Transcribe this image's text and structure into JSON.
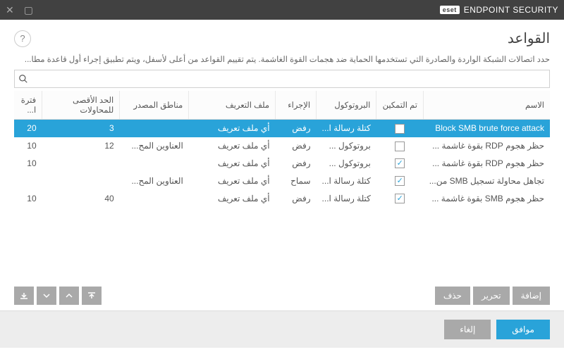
{
  "titlebar": {
    "brand_badge": "eset",
    "brand_text": "ENDPOINT SECURITY"
  },
  "header": {
    "title": "القواعد"
  },
  "description": "حدد اتصالات الشبكة الواردة والصادرة التي تستخدمها الحماية ضد هجمات القوة الغاشمة. يتم تقييم القواعد من أعلى لأسفل، ويتم تطبيق إجراء أول قاعدة مطا...",
  "search": {
    "placeholder": ""
  },
  "columns": {
    "name": "الاسم",
    "enabled": "تم التمكين",
    "protocol": "البروتوكول",
    "action": "الإجراء",
    "profile": "ملف التعريف",
    "source": "مناطق المصدر",
    "maxattempts": "الحد الأقصى للمحاولات",
    "period": "فترة ا..."
  },
  "rows": [
    {
      "name": "Block SMB brute force attack",
      "enabled": false,
      "protocol": "كتلة رسالة ا...",
      "action": "رفض",
      "profile": "أي ملف تعريف",
      "source": "",
      "maxattempts": "3",
      "period": "20",
      "selected": true
    },
    {
      "name": "حظر هجوم RDP بقوة غاشمة ...",
      "enabled": false,
      "protocol": "بروتوكول ...",
      "action": "رفض",
      "profile": "أي ملف تعريف",
      "source": "العناوين المح...",
      "maxattempts": "12",
      "period": "10"
    },
    {
      "name": "حظر هجوم RDP بقوة غاشمة ...",
      "enabled": true,
      "protocol": "بروتوكول ...",
      "action": "رفض",
      "profile": "أي ملف تعريف",
      "source": "",
      "maxattempts": "",
      "period": "10"
    },
    {
      "name": "تجاهل محاولة تسجيل SMB من...",
      "enabled": true,
      "protocol": "كتلة رسالة ا...",
      "action": "سماح",
      "profile": "أي ملف تعريف",
      "source": "العناوين المح...",
      "maxattempts": "",
      "period": ""
    },
    {
      "name": "حظر هجوم SMB بقوة غاشمة ...",
      "enabled": true,
      "protocol": "كتلة رسالة ا...",
      "action": "رفض",
      "profile": "أي ملف تعريف",
      "source": "",
      "maxattempts": "40",
      "period": "10"
    }
  ],
  "buttons": {
    "add": "إضافة",
    "edit": "تحرير",
    "delete": "حذف",
    "ok": "موافق",
    "cancel": "إلغاء"
  }
}
